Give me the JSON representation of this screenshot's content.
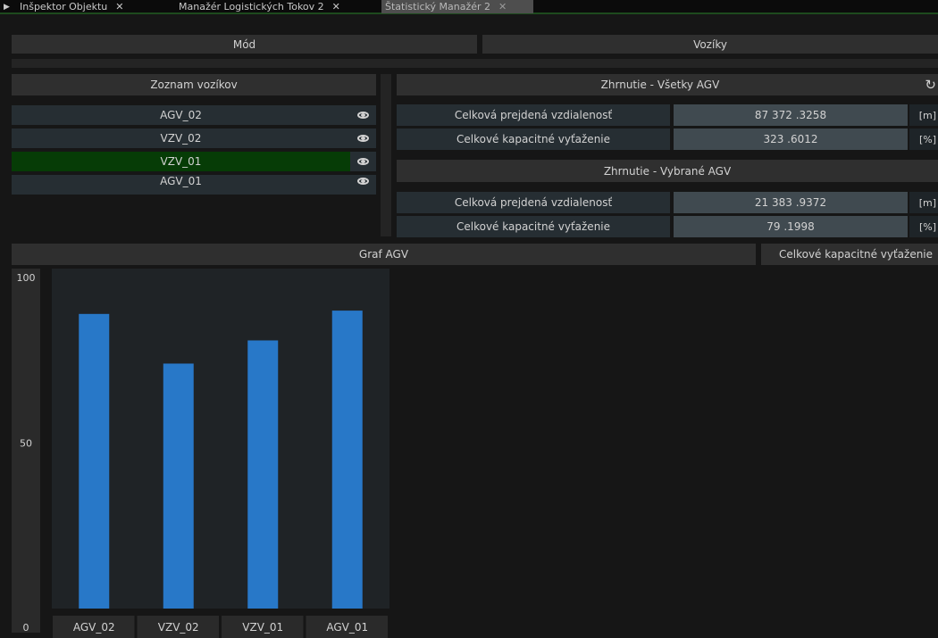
{
  "tabs": [
    {
      "label": "Inšpektor Objektu",
      "active": false
    },
    {
      "label": "Manažér Logistických Tokov 2",
      "active": false
    },
    {
      "label": "Štatistický Manažér 2",
      "active": true
    }
  ],
  "top_buttons": {
    "mode": "Mód",
    "vehicles": "Vozíky"
  },
  "vehicle_list": {
    "header": "Zoznam vozíkov",
    "items": [
      {
        "name": "AGV_02",
        "selected": false
      },
      {
        "name": "VZV_02",
        "selected": false
      },
      {
        "name": "VZV_01",
        "selected": true
      },
      {
        "name": "AGV_01",
        "selected": false
      }
    ]
  },
  "summary_all": {
    "header": "Zhrnutie - Všetky AGV",
    "rows": [
      {
        "label": "Celková prejdená vzdialenosť",
        "value": "87 372 .3258",
        "unit": "[m]"
      },
      {
        "label": "Celkové kapacitné vyťaženie",
        "value": "323 .6012",
        "unit": "[%]"
      }
    ]
  },
  "summary_selected": {
    "header": "Zhrnutie - Vybrané AGV",
    "rows": [
      {
        "label": "Celková prejdená vzdialenosť",
        "value": "21 383 .9372",
        "unit": "[m]"
      },
      {
        "label": "Celkové kapacitné vyťaženie",
        "value": "79 .1998",
        "unit": "[%]"
      }
    ]
  },
  "graph": {
    "title": "Graf AGV",
    "metric_button": "Celkové kapacitné vyťaženie"
  },
  "colors": {
    "bar": "#2878c8",
    "selected_row": "#063c06",
    "tab_accent": "#1d4a1d"
  },
  "chart_data": {
    "type": "bar",
    "categories": [
      "AGV_02",
      "VZV_02",
      "VZV_01",
      "AGV_01"
    ],
    "values": [
      89,
      74,
      81,
      90
    ],
    "ylim": [
      0,
      100
    ],
    "yticks": [
      0,
      50,
      100
    ]
  }
}
